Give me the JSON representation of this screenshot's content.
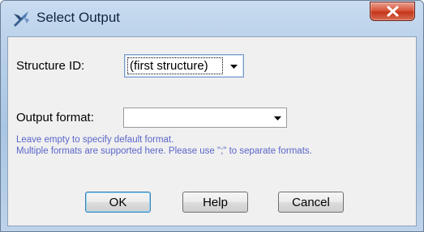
{
  "window": {
    "title": "Select Output",
    "icon": "chimera-x-icon",
    "close_icon": "close-x-icon"
  },
  "structure": {
    "label": "Structure ID:",
    "value": "(first structure)"
  },
  "output": {
    "label": "Output format:",
    "value": ""
  },
  "hints": [
    "Leave empty to specify default format.",
    "Multiple formats are supported here. Please use \";\" to separate formats."
  ],
  "buttons": {
    "ok": "OK",
    "help": "Help",
    "cancel": "Cancel"
  },
  "colors": {
    "hint_text": "#5a66c8",
    "close_button": "#c3371c",
    "default_button_border": "#3c7fb1"
  }
}
